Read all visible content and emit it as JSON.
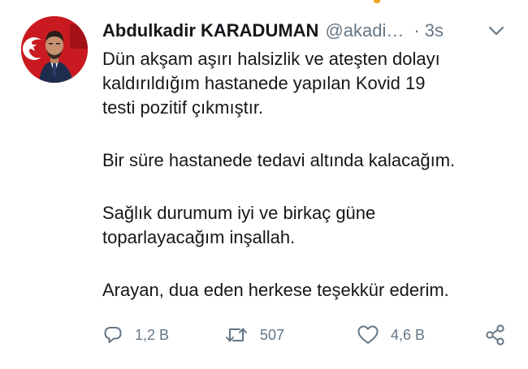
{
  "tweet": {
    "author": {
      "display_name": "Abdulkadir KARADUMAN",
      "handle": "@akadi…"
    },
    "separator": "·",
    "time": "3s",
    "paragraphs": [
      "Dün akşam aşırı halsizlik ve ateşten dolayı\nkaldırıldığım hastanede yapılan Kovid 19\ntesti pozitif çıkmıştır.",
      "Bir süre hastanede tedavi altında kalacağım.",
      "Sağlık durumum iyi ve birkaç güne\ntoparlayacağım inşallah.",
      "Arayan, dua eden herkese teşekkür ederim."
    ],
    "actions": {
      "replies": "1,2 B",
      "retweets": "507",
      "likes": "4,6 B"
    }
  },
  "icons": {
    "menu": "chevron-down-icon",
    "reply": "reply-icon",
    "retweet": "retweet-icon",
    "like": "heart-icon",
    "share": "share-icon"
  },
  "colors": {
    "text": "#14171a",
    "secondary": "#657786",
    "avatar_background": "#c4161c"
  }
}
